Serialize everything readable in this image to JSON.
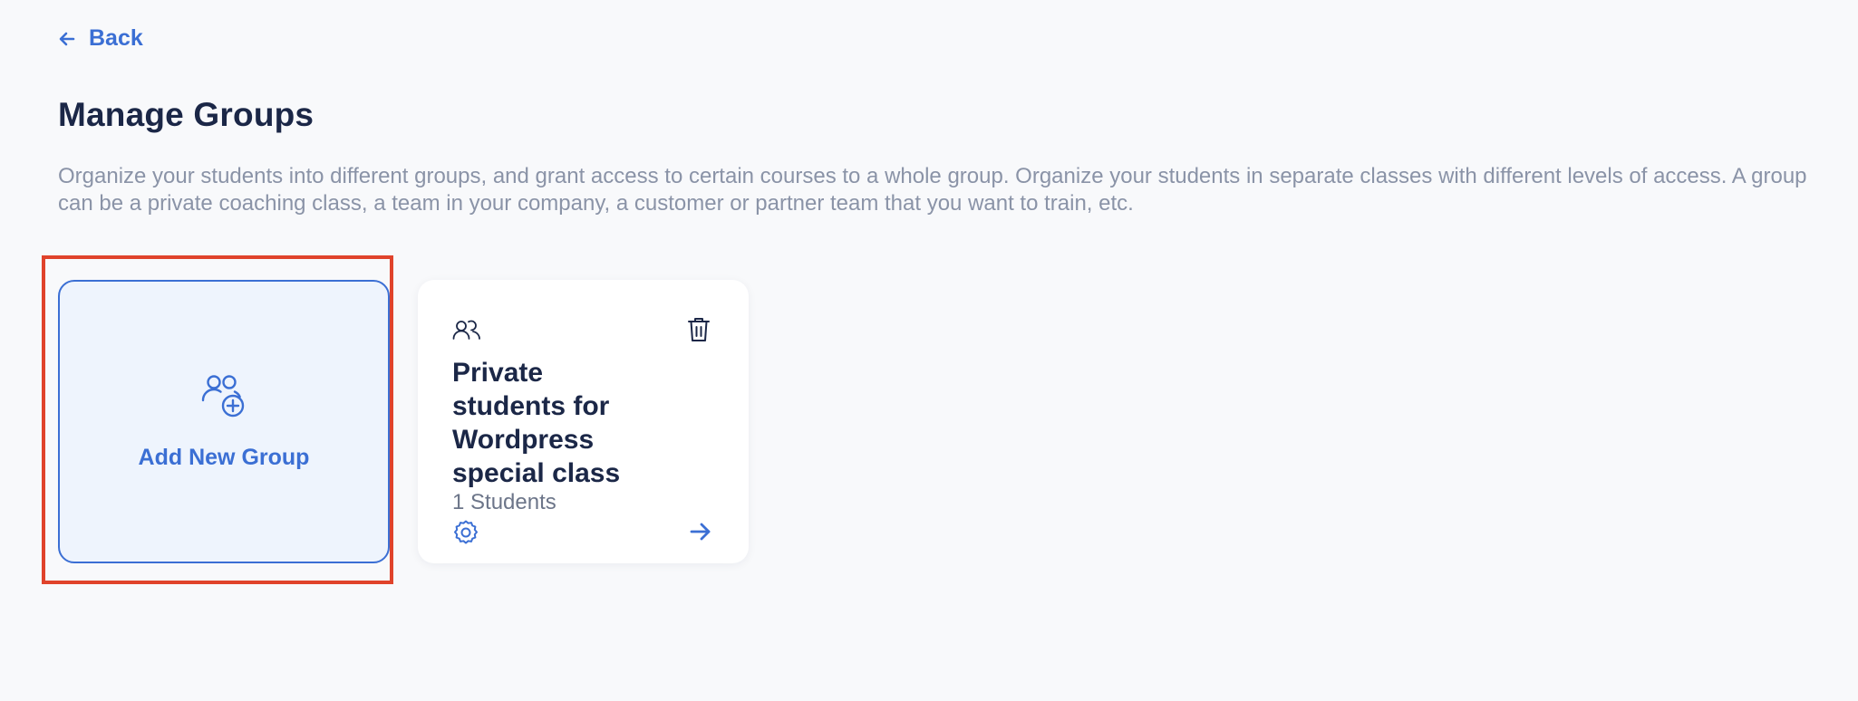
{
  "nav": {
    "back_label": "Back",
    "back_icon": "arrow-left-icon"
  },
  "page": {
    "title": "Manage Groups",
    "description": "Organize your students into different groups, and grant access to certain courses to a whole group. Organize your students in separate classes with different levels of access. A group can be a private coaching class, a team in your company, a customer or partner team that you want to train, etc."
  },
  "add_group": {
    "label": "Add New Group",
    "icon": "users-plus-icon"
  },
  "groups": [
    {
      "name": "Private students for Wordpress special class",
      "student_count": "1 Students",
      "icons": {
        "group": "users-icon",
        "delete": "trash-icon",
        "settings": "gear-icon",
        "open": "arrow-right-icon"
      }
    }
  ],
  "colors": {
    "accent": "#3b6fd4",
    "title": "#1b2747",
    "muted": "#8a93a7",
    "background": "#f8f9fb",
    "add_card_bg": "#eef4fd",
    "highlight": "#e0432b"
  }
}
